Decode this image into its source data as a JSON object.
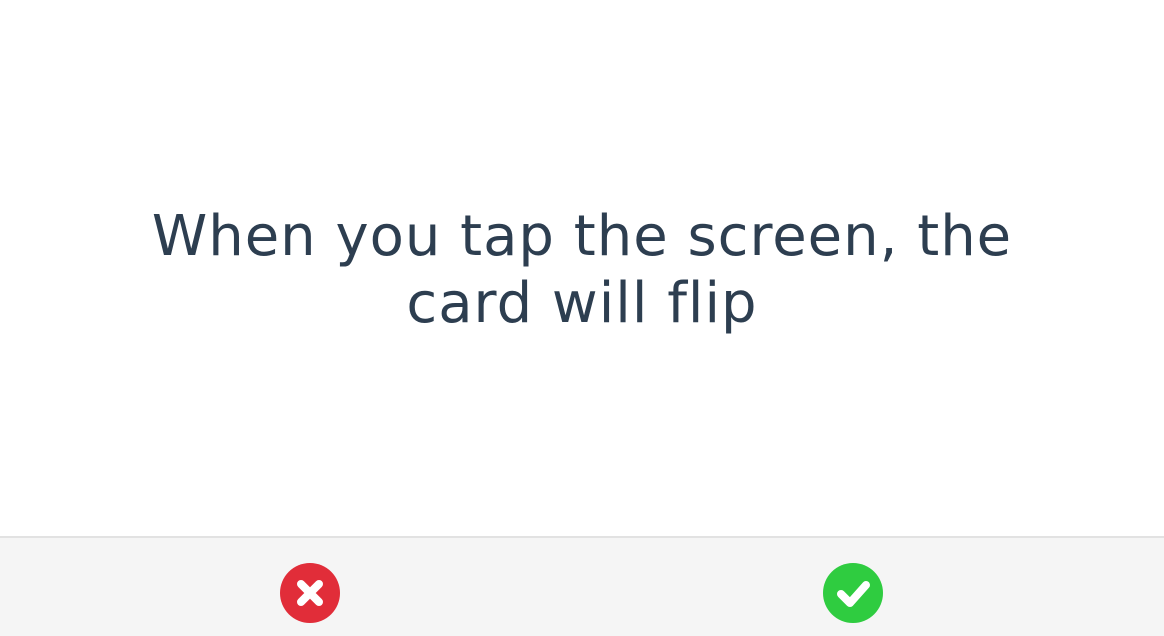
{
  "card": {
    "text": "When you tap the screen, the card will flip"
  },
  "actions": {
    "wrong": {
      "icon": "x-icon",
      "color": "#e12d39"
    },
    "right": {
      "icon": "checkmark-icon",
      "color": "#2fcc40"
    }
  },
  "colors": {
    "card_text": "#2d3e50",
    "card_background": "#ffffff",
    "toolbar_background": "#f5f5f5",
    "toolbar_border": "#e2e2e2"
  }
}
